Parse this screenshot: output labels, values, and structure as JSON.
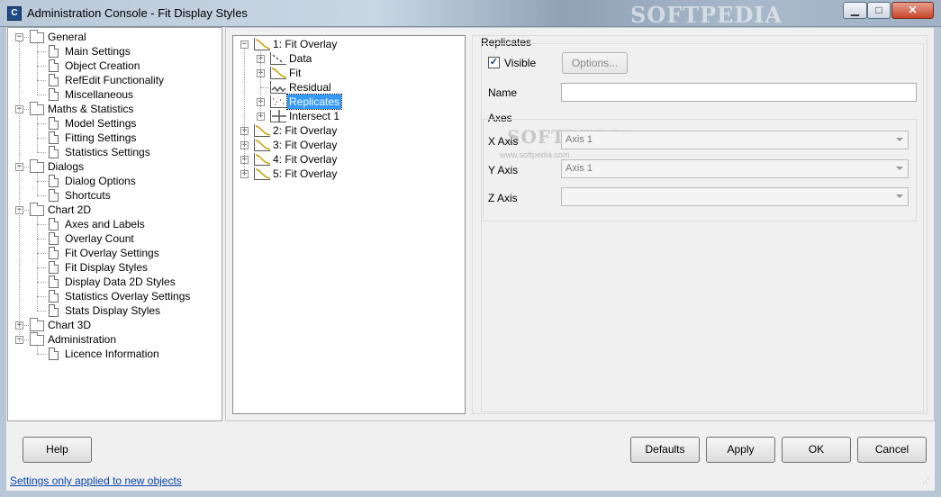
{
  "window": {
    "title": "Administration Console - Fit Display Styles",
    "app_icon": "C",
    "watermark": "SOFTPEDIA",
    "minimize_icon": "minimize-icon",
    "maximize_icon": "maximize-icon",
    "close_icon": "close-icon",
    "min_glyph": "▁",
    "max_glyph": "□",
    "close_glyph": "✕"
  },
  "nav": {
    "groups": [
      {
        "label": "General",
        "expanded": true,
        "items": [
          "Main Settings",
          "Object Creation",
          "RefEdit Functionality",
          "Miscellaneous"
        ]
      },
      {
        "label": "Maths & Statistics",
        "expanded": true,
        "items": [
          "Model Settings",
          "Fitting Settings",
          "Statistics Settings"
        ]
      },
      {
        "label": "Dialogs",
        "expanded": true,
        "items": [
          "Dialog Options",
          "Shortcuts"
        ]
      },
      {
        "label": "Chart 2D",
        "expanded": true,
        "items": [
          "Axes and Labels",
          "Overlay Count",
          "Fit Overlay Settings",
          "Fit Display Styles",
          "Display Data 2D Styles",
          "Statistics Overlay Settings",
          "Stats Display Styles"
        ]
      },
      {
        "label": "Chart 3D",
        "expanded": false,
        "items": []
      },
      {
        "label": "Administration",
        "expanded": true,
        "items": [
          "Licence Information"
        ]
      }
    ]
  },
  "overlays": {
    "root": "1: Fit Overlay",
    "children": [
      "Data",
      "Fit",
      "Residual",
      "Replicates",
      "Intersect 1"
    ],
    "selected": "Replicates",
    "others": [
      "2: Fit Overlay",
      "3: Fit Overlay",
      "4: Fit Overlay",
      "5: Fit Overlay"
    ]
  },
  "props": {
    "section_title": "Replicates",
    "visible_label": "Visible",
    "visible_checked": true,
    "options_label": "Options...",
    "name_label": "Name",
    "name_value": "",
    "axes_title": "Axes",
    "x_axis_label": "X Axis",
    "x_axis_value": "Axis 1",
    "y_axis_label": "Y Axis",
    "y_axis_value": "Axis 1",
    "z_axis_label": "Z Axis",
    "z_axis_value": "",
    "wm_text": "SOFTPEDIA",
    "wm_url": "www.softpedia.com"
  },
  "footer": {
    "help": "Help",
    "defaults": "Defaults",
    "apply": "Apply",
    "ok": "OK",
    "cancel": "Cancel",
    "link": "Settings only applied to new objects"
  }
}
